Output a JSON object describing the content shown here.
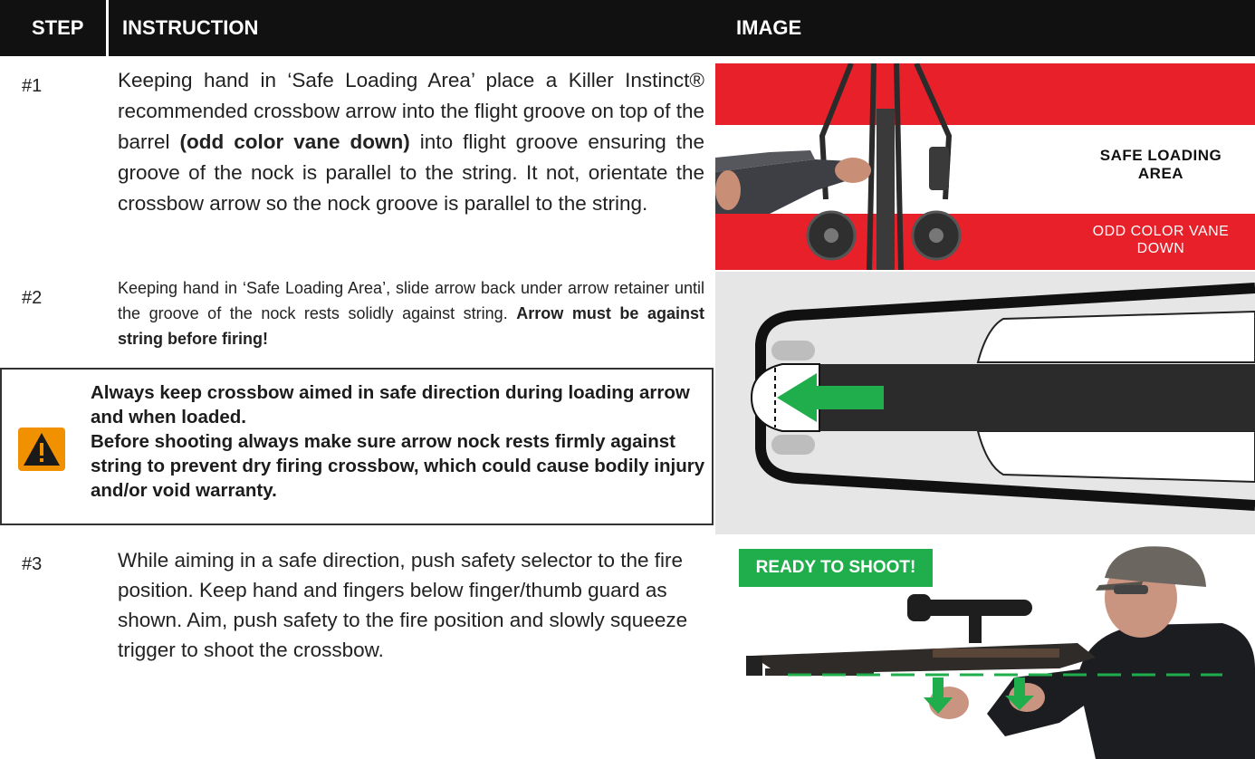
{
  "header": {
    "step": "STEP",
    "instruction": "INSTRUCTION",
    "image": "IMAGE"
  },
  "steps": [
    {
      "num": "#1",
      "text": "Keeping hand in ‘Safe Loading Area’ place a Killer Instinct® recommended crossbow arrow into the flight groove on top of the barrel ",
      "bold": "(odd color vane down)",
      "text_after": " into flight groove ensuring the groove of the nock is parallel to the string. It not, orientate the crossbow arrow so the nock groove is parallel to the string."
    },
    {
      "num": "#2",
      "text": "Keeping hand in ‘Safe Loading Area’, slide arrow back under arrow retainer until the groove of the nock rests solidly against string. ",
      "bold": "Arrow must be against string before firing!"
    },
    {
      "num": "#3",
      "text": "While aiming in a safe direction, push safety selector to the fire position. Keep hand and fingers below finger/thumb guard as shown. Aim, push safety to the fire position and slowly squeeze trigger to shoot the crossbow."
    }
  ],
  "warning": {
    "line1": "Always keep crossbow aimed in safe direction during loading arrow and when loaded.",
    "line2": "Before shooting always make sure arrow nock rests firmly against string to prevent dry firing crossbow, which could cause bodily injury and/or void warranty."
  },
  "images": {
    "safe_loading_area": "SAFE LOADING AREA",
    "odd_color_vane": "ODD COLOR VANE DOWN",
    "ready_to_shoot": "READY TO SHOOT!"
  },
  "colors": {
    "header_bg": "#111111",
    "red_band": "#e8202a",
    "green_accent": "#1fae4b",
    "warning_orange": "#f29100"
  }
}
